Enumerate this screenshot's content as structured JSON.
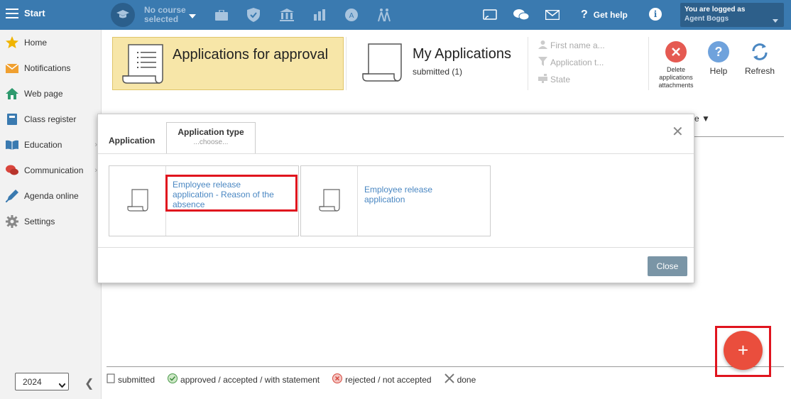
{
  "topbar": {
    "start_label": "Start",
    "course_line1": "No course",
    "course_line2": "selected",
    "get_help": "Get help",
    "login_line1": "You are logged as",
    "login_line2": "Agent Boggs",
    "bg_color": "#3a7ab0"
  },
  "sidebar": {
    "items": [
      {
        "label": "Home",
        "icon": "star-icon"
      },
      {
        "label": "Notifications",
        "icon": "envelope-icon"
      },
      {
        "label": "Web page",
        "icon": "house-icon"
      },
      {
        "label": "Class register",
        "icon": "book-icon"
      },
      {
        "label": "Education",
        "icon": "open-book-icon"
      },
      {
        "label": "Communication",
        "icon": "chat-icon"
      },
      {
        "label": "Agenda online",
        "icon": "pen-icon"
      },
      {
        "label": "Settings",
        "icon": "gear-icon"
      }
    ],
    "year": "2024"
  },
  "header": {
    "approval_title": "Applications for approval",
    "my_title": "My Applications",
    "my_sub": "submitted (1)",
    "filters": [
      "First name a...",
      "Application t...",
      "State"
    ],
    "delete_label_1": "Delete",
    "delete_label_2": "applications",
    "delete_label_3": "attachments",
    "help_label": "Help",
    "refresh_label": "Refresh",
    "partial_column": "e"
  },
  "modal": {
    "tab_application": "Application",
    "tab_type": "Application type",
    "tab_type_hint": "...choose...",
    "card1_line1": "Employee release",
    "card1_line2": "application - Reason of the",
    "card1_line3": "absence",
    "card2_line1": "Employee release",
    "card2_line2": "application",
    "close_label": "Close"
  },
  "legend": {
    "submitted": "submitted",
    "approved": "approved / accepted / with statement",
    "rejected": "rejected / not accepted",
    "done": "done"
  },
  "fab_label": "+"
}
